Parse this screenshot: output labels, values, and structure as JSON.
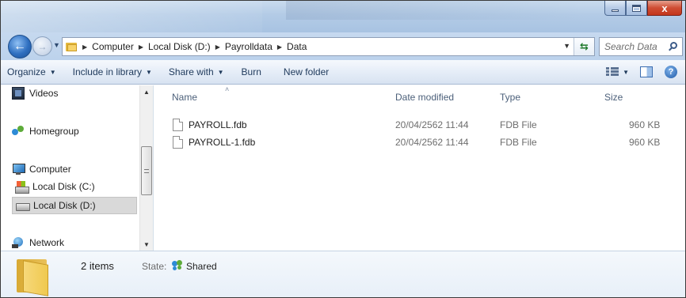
{
  "window": {
    "minimize_glyph": "",
    "close_glyph": "x"
  },
  "navigation": {
    "back_glyph": "←",
    "forward_glyph": "→",
    "recent_glyph": "▼"
  },
  "address": {
    "breadcrumb": [
      "Computer",
      "Local Disk (D:)",
      "Payrolldata",
      "Data"
    ],
    "separator": "▶",
    "dropdown_glyph": "▼",
    "refresh_glyph": "⇆"
  },
  "search": {
    "placeholder": "Search Data"
  },
  "toolbar": {
    "organize": "Organize",
    "include_in_library": "Include in library",
    "share_with": "Share with",
    "burn": "Burn",
    "new_folder": "New folder",
    "caret": "▼",
    "help": "?"
  },
  "sidebar": {
    "items": [
      {
        "label": "Videos",
        "icon": "videos-icon"
      },
      {
        "label": "Homegroup",
        "icon": "homegroup-icon"
      },
      {
        "label": "Computer",
        "icon": "computer-icon"
      },
      {
        "label": "Local Disk (C:)",
        "icon": "local-disk-icon"
      },
      {
        "label": "Local Disk (D:)",
        "icon": "local-disk-icon",
        "selected": true
      },
      {
        "label": "Network",
        "icon": "network-icon"
      }
    ],
    "scroll_up": "▲",
    "scroll_down": "▼"
  },
  "columns": {
    "name": "Name",
    "date_modified": "Date modified",
    "type": "Type",
    "size": "Size",
    "sort_glyph": "˄"
  },
  "files": [
    {
      "name": "PAYROLL.fdb",
      "date_modified": "20/04/2562 11:44",
      "type": "FDB File",
      "size": "960 KB"
    },
    {
      "name": "PAYROLL-1.fdb",
      "date_modified": "20/04/2562 11:44",
      "type": "FDB File",
      "size": "960 KB"
    }
  ],
  "status": {
    "items_count": "2 items",
    "state_label": "State:",
    "state_value": "Shared"
  }
}
